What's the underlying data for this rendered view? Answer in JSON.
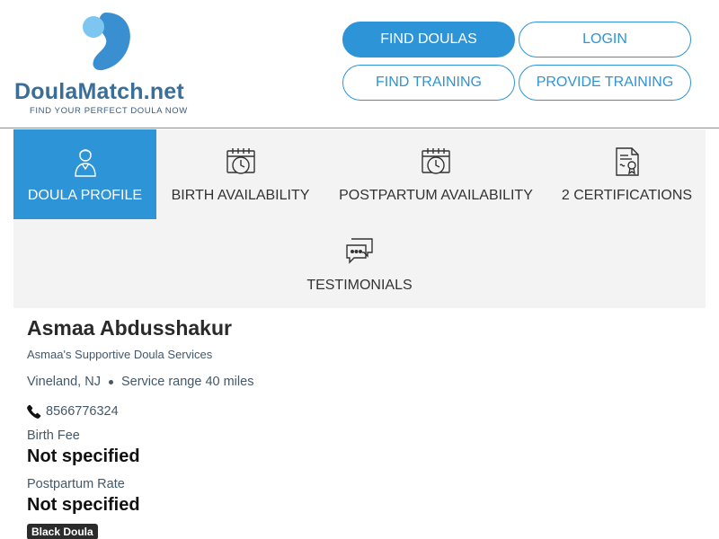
{
  "header": {
    "logo_word": "DoulaMatch.net",
    "logo_tagline": "FIND YOUR PERFECT DOULA NOW",
    "buttons": {
      "find_doulas": "FIND DOULAS",
      "login": "LOGIN",
      "find_training": "FIND TRAINING",
      "provide_training": "PROVIDE TRAINING"
    }
  },
  "tabs": [
    {
      "label": "DOULA PROFILE",
      "icon": "doula-person-icon",
      "active": true
    },
    {
      "label": "BIRTH AVAILABILITY",
      "icon": "calendar-clock-icon",
      "active": false
    },
    {
      "label": "POSTPARTUM AVAILABILITY",
      "icon": "calendar-clock-icon",
      "active": false
    },
    {
      "label": "2 CERTIFICATIONS",
      "icon": "certificate-icon",
      "active": false
    },
    {
      "label": "TESTIMONIALS",
      "icon": "chat-bubbles-icon",
      "active": false
    }
  ],
  "profile": {
    "name": "Asmaa Abdusshakur",
    "business": "Asmaa's Supportive Doula Services",
    "location": "Vineland, NJ",
    "service_range": "Service range 40 miles",
    "phone": "8566776324",
    "birth_fee_label": "Birth Fee",
    "birth_fee_value": "Not specified",
    "postpartum_rate_label": "Postpartum Rate",
    "postpartum_rate_value": "Not specified",
    "badge": "Black Doula"
  },
  "colors": {
    "accent": "#2d94d8",
    "logo_dark": "#3a6e98",
    "logo_light": "#7cc6f0",
    "tab_bg": "#f3f3f3",
    "muted_text": "#44586a",
    "badge_bg": "#2b2b2b"
  }
}
